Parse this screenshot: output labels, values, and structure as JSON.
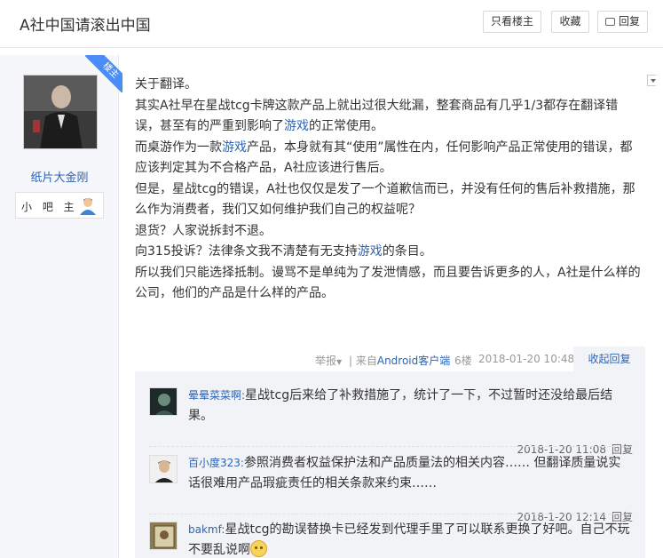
{
  "header": {
    "title": "A社中国请滚出中国",
    "only_author_label": "只看楼主",
    "favorite_label": "收藏",
    "reply_label": "回复"
  },
  "author": {
    "badge": "楼主",
    "name": "纸片大金刚",
    "rank_label": "小 吧 主"
  },
  "post": {
    "paragraphs": [
      [
        "关于翻译。"
      ],
      [
        "其实A社早在星战tcg卡牌这款产品上就出过很大纰漏，整套商品有几乎1/3都存在翻译错误，甚至有的严重到影响了",
        {
          "link": "游戏"
        },
        "的正常使用。"
      ],
      [
        "而桌游作为一款",
        {
          "link": "游戏"
        },
        "产品，本身就有其“使用”属性在内，任何影响产品正常使用的错误，都应该判定其为不合格产品，A社应该进行售后。"
      ],
      [
        "但是，星战tcg的错误，A社也仅仅是发了一个道歉信而已，并没有任何的售后补救措施，那么作为消费者，我们又如何维护我们自己的权益呢？"
      ],
      [
        "退货？人家说拆封不退。"
      ],
      [
        "向315投诉？法律条文我不清楚有无支持",
        {
          "link": "游戏"
        },
        "的条目。"
      ],
      [
        "所以我们只能选择抵制。谩骂不是单纯为了发泄情感，而且要告诉更多的人，A社是什么样的公司，他们的产品是什么样的产品。"
      ]
    ],
    "report_label": "举报",
    "source_prefix": "| 来自",
    "source_link": "Android客户端",
    "floor": "6楼",
    "timestamp": "2018-01-20 10:48",
    "collapse_reply_label": "收起回复"
  },
  "replies": [
    {
      "user": "晕晕菜菜啊:",
      "text": "星战tcg后来给了补救措施了，统计了一下，不过暂时还没给最后结果。",
      "time": "2018-1-20 11:08",
      "reply_label": "回复"
    },
    {
      "user": "百小度323:",
      "text": "参照消费者权益保护法和产品质量法的相关内容…… 但翻译质量说实话很难用产品瑕疵责任的相关条款来约束……",
      "time": "2018-1-20 12:14",
      "reply_label": "回复"
    },
    {
      "user": "bakmf:",
      "text": "星战tcg的勘误替换卡已经发到代理手里了可以联系更换了好吧。自己不玩不要乱说啊",
      "emoji": "smile-emoji"
    }
  ],
  "colors": {
    "link": "#2d64b3",
    "badge": "#4a8df8",
    "sidebar_bg": "#f6f7fb",
    "reply_bg": "#f2f3f7"
  }
}
